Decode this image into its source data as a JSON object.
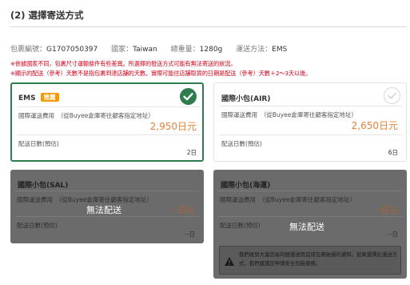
{
  "section": {
    "title": "(2) 選擇寄送方式"
  },
  "info": {
    "package_label": "包裹編號：",
    "package_value": "G1707050397",
    "country_label": "國家：",
    "country_value": "Taiwan",
    "weight_label": "總重量：",
    "weight_value": "1280g",
    "method_label": "運送方法：",
    "method_value": "EMS"
  },
  "warnings": [
    "※依據國家不同，包裹尺寸運輸條件有些差異。所選擇的發送方式可能有無法寄送的狀況。",
    "※顯示的配送（參考）天數不是指包裹到達店舖的天數。實際可能往店舖取貨的日期是配送（參考）天數＋2～3天以後。"
  ],
  "options": {
    "ems": {
      "name": "EMS",
      "badge": "推薦",
      "fee_label": "國際運送費用　（從Buyee倉庫寄往顧客指定地址）",
      "fee_value": "2,950日元",
      "days_label": "配送日數(預估)",
      "days_value": "2日",
      "selected": true
    },
    "air": {
      "name": "國際小包(AIR)",
      "fee_label": "國際運送費用　（從Buyee倉庫寄往顧客指定地址）",
      "fee_value": "2,650日元",
      "days_label": "配送日數(預估)",
      "days_value": "6日",
      "selected": false
    },
    "sal": {
      "name": "國際小包(SAL)",
      "fee_label": "國際運送費用　（從Buyee倉庫寄往顧客指定地址）",
      "fee_value": "--日元",
      "days_label": "配送日數(預估)",
      "days_value": "--日",
      "unavailable": "無法配送"
    },
    "sea": {
      "name": "國際小包(海運)",
      "fee_label": "國際運送費用　（從Buyee倉庫寄往顧客指定地址）",
      "fee_value": "--日元",
      "days_label": "配送日數(預估)",
      "days_value": "--日",
      "unavailable": "無法配送",
      "notice": "我們收到大量因長時間運送而造成包裹破損的通知。如果選擇此運送方式，我們建議您申請安全包裝服務。"
    }
  },
  "colors": {
    "accent": "#2e7d4f",
    "price": "#e8833a",
    "warning": "#d0021b",
    "badge": "#f39800"
  },
  "icons": {
    "selected": "check-circle-icon",
    "unselected": "check-circle-outline-icon",
    "notice": "warning-triangle-icon"
  }
}
